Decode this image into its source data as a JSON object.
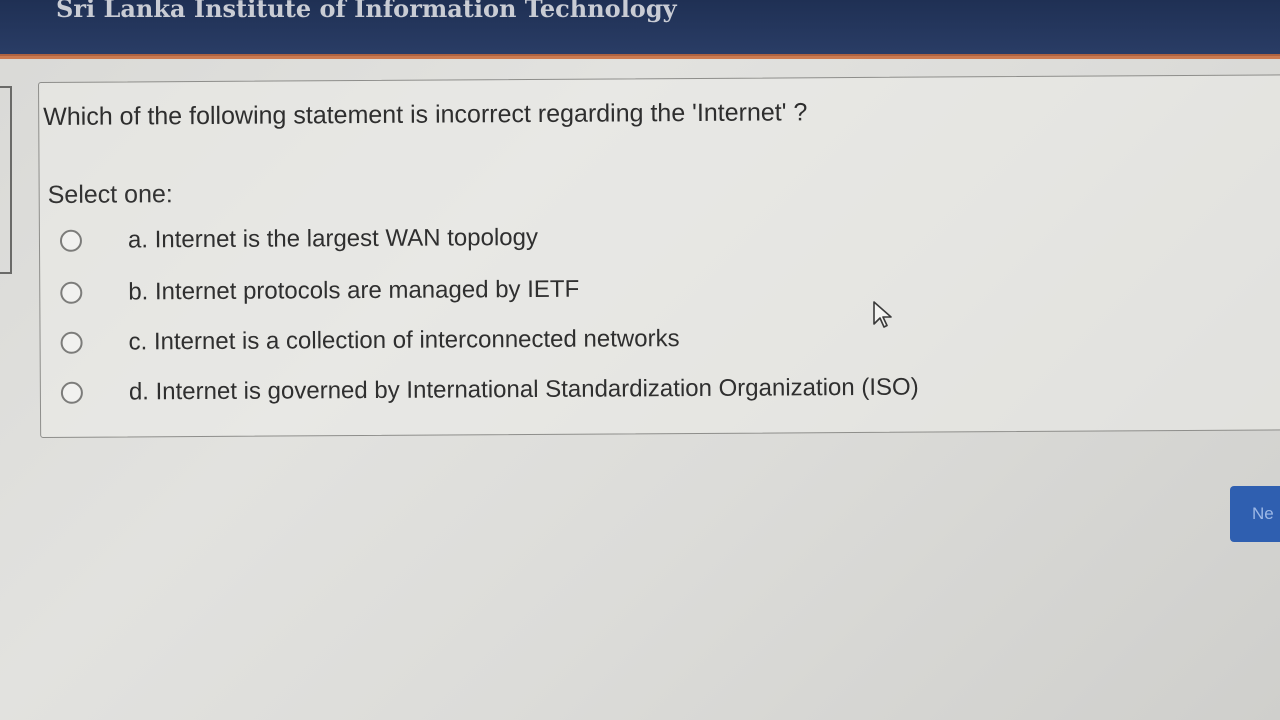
{
  "header": {
    "site_title": "Sri Lanka Institute of Information Technology"
  },
  "question": {
    "text": "Which of the following statement is incorrect regarding the 'Internet' ?",
    "prompt": "Select one:",
    "options": [
      {
        "label": "a. Internet is the largest WAN topology",
        "selected": false
      },
      {
        "label": "b. Internet protocols are managed by IETF",
        "selected": false
      },
      {
        "label": "c. Internet is a collection of interconnected networks",
        "selected": false
      },
      {
        "label": "d. Internet is governed by International Standardization Organization (ISO)",
        "selected": false
      }
    ]
  },
  "navigation": {
    "next_label": "Ne"
  },
  "icons": {
    "cursor": "mouse-pointer-icon",
    "radio": "radio-button-icon"
  },
  "colors": {
    "header_bg": "#253862",
    "header_accent": "#c86a3a",
    "next_button": "#2f5fb0"
  }
}
